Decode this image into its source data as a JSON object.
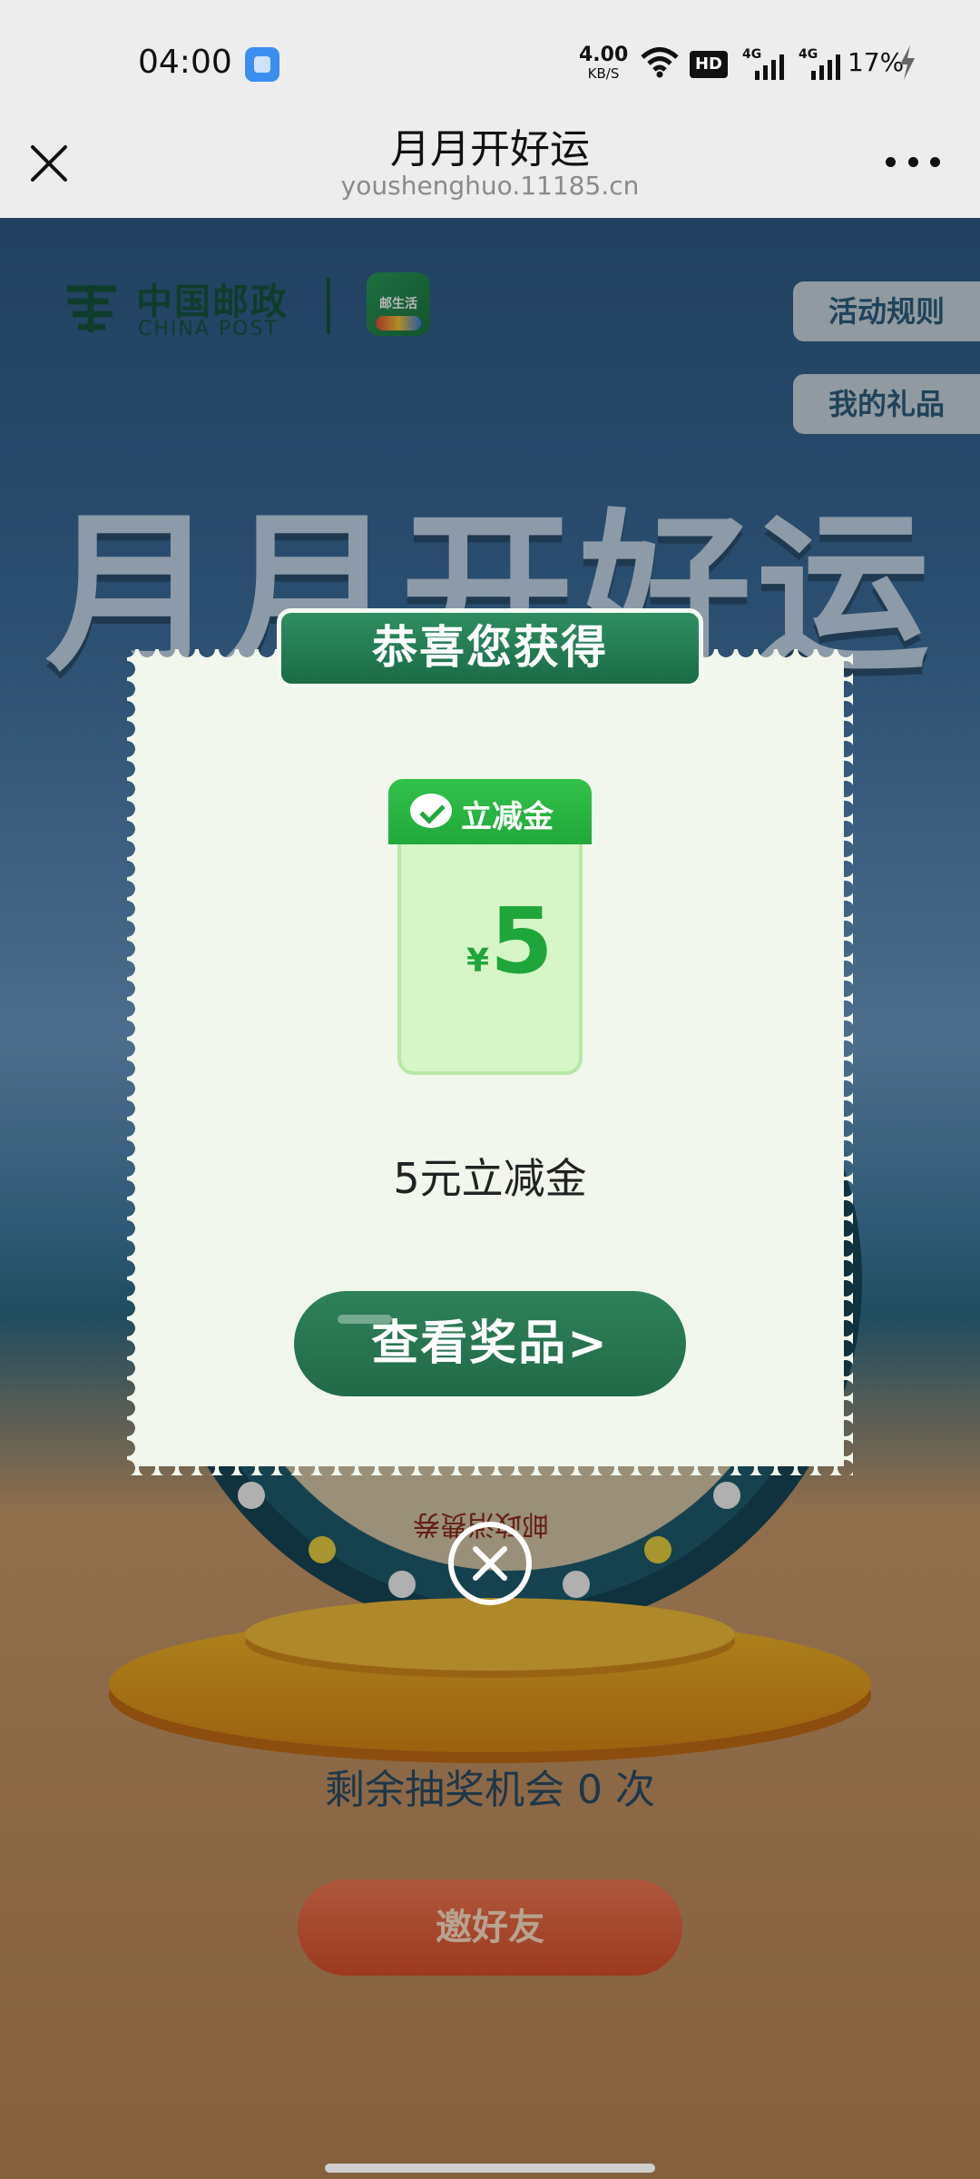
{
  "status_bar": {
    "time": "04:00",
    "net_speed_value": "4.00",
    "net_speed_unit": "KB/S",
    "hd_label": "HD",
    "signal_1_label": "4G",
    "signal_2_label": "4G",
    "battery": "17%"
  },
  "nav": {
    "title": "月月开好运",
    "domain": "youshenghuo.11185.cn"
  },
  "background_page": {
    "logo_cn": "中国邮政",
    "logo_en": "CHINA POST",
    "app_icon_label": "邮生活",
    "rules_button": "活动规则",
    "my_gifts_button": "我的礼品",
    "hero_title": "月月开好运",
    "wheel_segment_label": "邮政消费券",
    "remaining_chances": "剩余抽奖机会 0 次",
    "invite_button": "邀好友"
  },
  "modal": {
    "header": "恭喜您获得",
    "coupon_title": "立减金",
    "coupon_currency": "¥",
    "coupon_amount": "5",
    "prize_name": "5元立减金",
    "view_prize_button": "查看奖品>"
  }
}
